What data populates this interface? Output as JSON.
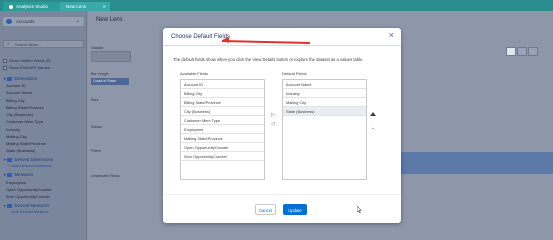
{
  "topbar": {
    "tabs": [
      {
        "label": "Analytics Studio"
      },
      {
        "label": "New Lens"
      }
    ]
  },
  "sidebar": {
    "dataset": "Accounts",
    "search_placeholder": "Search fields...",
    "checkboxes": [
      "Show Hidden Fields (0)",
      "Show Field API Names"
    ],
    "dimensions_header": "Dimensions",
    "dimensions": [
      "Account ID",
      "Account Name",
      "Billing City",
      "Billing State/Province",
      "City (Business)",
      "Customer Mem Type",
      "Industry",
      "Mailing City",
      "Mailing State/Province",
      "State (Business)"
    ],
    "derived_dimensions_header": "Derived Dimensions",
    "add_derived_dimension": "+ Add Derived Dimension",
    "measures_header": "Measures",
    "measures": [
      "Employees",
      "Open OpportunityCounter",
      "Won OpportunityCounter"
    ],
    "derived_measures_header": "Derived Measures",
    "add_derived_measure": "+ Add Derived Measure"
  },
  "main": {
    "title": "New Lens",
    "labels": {
      "dataset": "Dataset",
      "bar_length": "Bar Length",
      "bars": "Bars",
      "stacks": "Stacks",
      "filters": "Filters",
      "unselected": "Unselected Fields",
      "count_of_rows": "Count of Rows"
    }
  },
  "modal": {
    "title": "Choose Default Fields",
    "description": "The default fields show when you click the View Details button or explore the dataset as a values table.",
    "available_label": "Available Fields",
    "available_fields": [
      "Account ID",
      "Billing City",
      "Billing State/Province",
      "City (Business)",
      "Customer Mem Type",
      "Employees",
      "Mailing State/Province",
      "Open OpportunityCounter",
      "Won OpportunityCounter"
    ],
    "default_label": "Default Fields",
    "default_fields": [
      "Account Name",
      "Industry",
      "Mailing City",
      "State (Business)"
    ],
    "selected_default": "State (Business)",
    "move_right": "▷",
    "move_left": "◁",
    "order_down": "⌄",
    "close": "×",
    "cancel_label": "Cancel",
    "update_label": "Update"
  },
  "colors": {
    "brand": "#0070d2",
    "header_teal": "#2a8c8c",
    "annotation": "#e03131"
  }
}
